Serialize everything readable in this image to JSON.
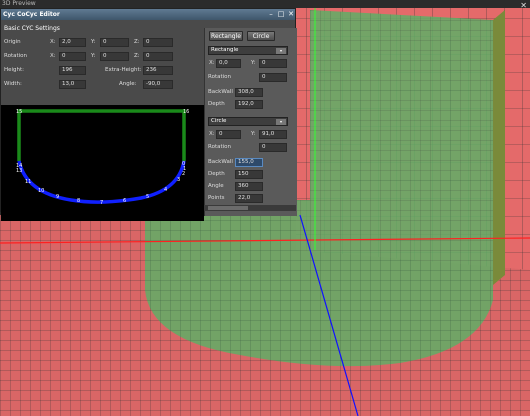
{
  "viewport": {
    "title": "3D Preview"
  },
  "editor": {
    "title": "Cyc CoCyc Editor",
    "section_label": "Basic CYC Settings",
    "origin": {
      "label": "Origin",
      "x_label": "X:",
      "x": "2,0",
      "y_label": "Y:",
      "y": "0",
      "z_label": "Z:",
      "z": "0"
    },
    "rotation": {
      "label": "Rotation",
      "x_label": "X:",
      "x": "0",
      "y_label": "Y:",
      "y": "0",
      "z_label": "Z:",
      "z": "0"
    },
    "height": {
      "label": "Height:",
      "value": "196"
    },
    "extra_height": {
      "label": "Extra-Height:",
      "value": "236"
    },
    "width": {
      "label": "Width:",
      "value": "13,0"
    },
    "angle": {
      "label": "Angle:",
      "value": "-90,0"
    },
    "preview_points": [
      "15",
      "16",
      "14",
      "13",
      "11",
      "10",
      "9",
      "8",
      "7",
      "6",
      "5",
      "4",
      "3",
      "2",
      "1",
      "0"
    ]
  },
  "panel": {
    "rectangle_button": "Rectangle",
    "circle_button": "Circle",
    "rect": {
      "type": "Rectangle",
      "x_label": "X:",
      "x": "0,0",
      "y_label": "Y:",
      "y": "0",
      "rotation_label": "Rotation",
      "rotation": "0",
      "backwall_label": "BackWall",
      "backwall": "308,0",
      "depth_label": "Depth",
      "depth": "192,0"
    },
    "circle": {
      "type": "Circle",
      "x_label": "X:",
      "x": "0",
      "y_label": "Y:",
      "y": "91,0",
      "rotation_label": "Rotation",
      "rotation": "0",
      "backwall_label": "BackWall",
      "backwall": "155,0",
      "depth_label": "Depth",
      "depth": "150",
      "angle_label": "Angle",
      "angle": "360",
      "points_label": "Points",
      "points": "22,0"
    }
  },
  "colors": {
    "floor": "#e06d6d",
    "wall": "#e66a6a",
    "green_shape": "#5fb06a",
    "preview_blue": "#1020ff",
    "preview_green": "#1a8a1a"
  }
}
